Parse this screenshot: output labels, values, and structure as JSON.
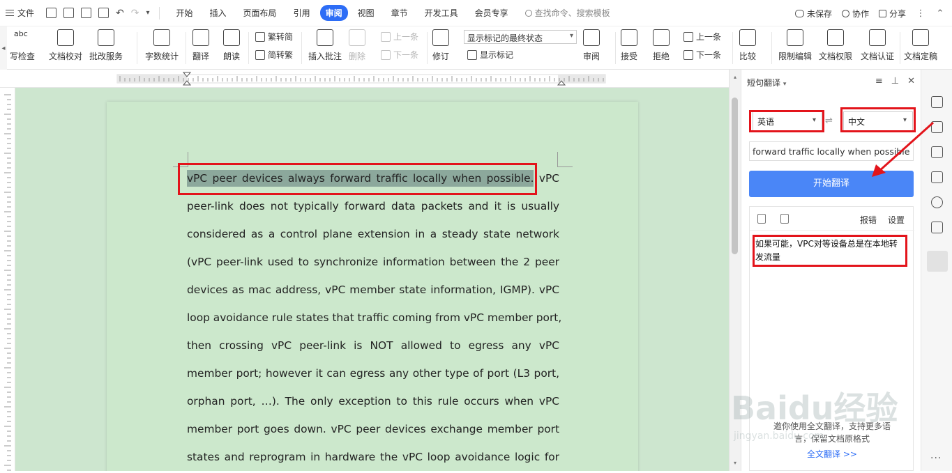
{
  "menubar": {
    "file_label": "文件",
    "tabs": [
      "开始",
      "插入",
      "页面布局",
      "引用",
      "审阅",
      "视图",
      "章节",
      "开发工具",
      "会员专享"
    ],
    "active_tab": "审阅",
    "search_placeholder": "查找命令、搜索模板",
    "unsaved": "未保存",
    "collaborate": "协作",
    "share": "分享"
  },
  "ribbon": {
    "spell_check": "写检查",
    "doc_proof": "文档校对",
    "batch_service": "批改服务",
    "word_count": "字数统计",
    "translate": "翻译",
    "read_aloud": "朗读",
    "trad_to_simp": "繁转简",
    "simp_to_trad": "简转繁",
    "insert_comment": "插入批注",
    "delete": "删除",
    "prev": "上一条",
    "next": "下一条",
    "track_changes": "修订",
    "display_mode": "显示标记的最终状态",
    "show_markup": "显示标记",
    "review": "审阅",
    "accept": "接受",
    "reject": "拒绝",
    "prev2": "上一条",
    "next2": "下一条",
    "compare": "比较",
    "restrict_edit": "限制编辑",
    "doc_permission": "文档权限",
    "doc_certify": "文档认证",
    "doc_finalize": "文档定稿"
  },
  "document": {
    "lines": [
      "peer-link does not typically forward data packets and it is usually",
      "considered as a control plane extension in a steady state network",
      "(vPC peer-link used to synchronize information between the 2 peer",
      "devices as mac address, vPC member state information, IGMP). vPC",
      "loop avoidance rule states that traffic coming from vPC member port,",
      "then crossing vPC peer-link is NOT allowed to egress any vPC",
      "member port; however it can egress any other type of port (L3 port,",
      "orphan port, …). The only exception to this rule occurs when vPC",
      "member port goes down. vPC peer devices exchange member port",
      "states and reprogram in hardware the vPC loop avoidance logic for"
    ],
    "highlighted": "vPC peer devices always forward traffic locally when possible.",
    "first_line_tail": " vPC"
  },
  "panel": {
    "title": "短句翻译",
    "source_lang": "英语",
    "target_lang": "中文",
    "source_text": "forward traffic locally when possible",
    "start_button": "开始翻译",
    "report": "报错",
    "settings": "设置",
    "result": "如果可能，VPC对等设备总是在本地转发流量",
    "footer_line1": "邀你使用全文翻译，支持更多语",
    "footer_line2": "言，保留文档原格式",
    "full_translate_link": "全文翻译 >>"
  },
  "watermark": {
    "brand": "Baidu经验",
    "url": "jingyan.baidu.com"
  },
  "colors": {
    "accent": "#2d6df6",
    "start_button": "#4a86f7",
    "annotation_red": "#e3141b",
    "doc_bg": "#cde6cf"
  }
}
